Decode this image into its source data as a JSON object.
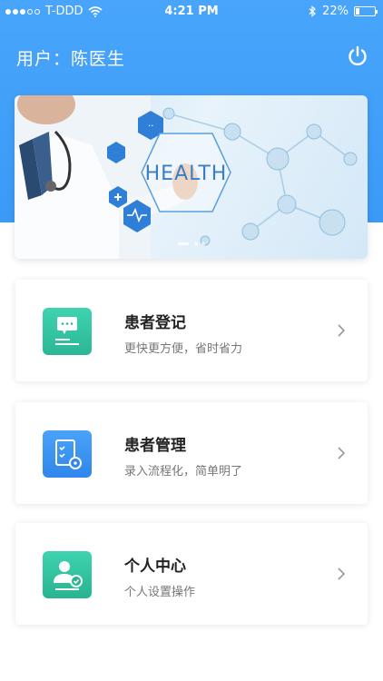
{
  "status_bar": {
    "carrier": "T-DDD",
    "time": "4:21 PM",
    "battery": "22%",
    "battery_level": 0.22
  },
  "header": {
    "user_label": "用户：陈医生"
  },
  "banner": {
    "text": "HEALTH"
  },
  "menu": [
    {
      "title": "患者登记",
      "subtitle": "更快更方便，省时省力",
      "icon": "registration-icon",
      "color": "#34c6a4"
    },
    {
      "title": "患者管理",
      "subtitle": "录入流程化，简单明了",
      "icon": "management-icon",
      "color": "#3a92f3"
    },
    {
      "title": "个人中心",
      "subtitle": "个人设置操作",
      "icon": "personal-center-icon",
      "color": "#2ec49f"
    }
  ],
  "colors": {
    "header": "#48a5fb",
    "accent_green": "#34c6a4",
    "accent_blue": "#3a92f3"
  }
}
